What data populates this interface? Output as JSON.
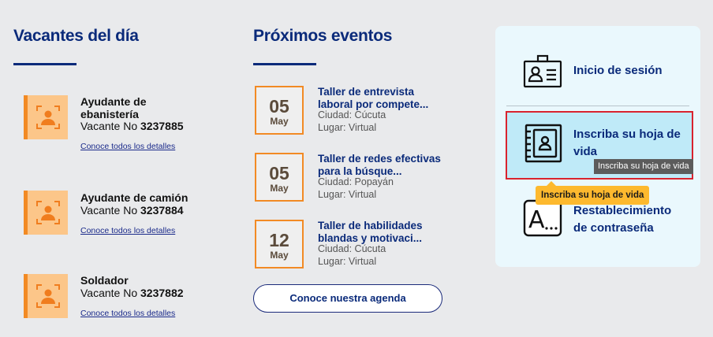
{
  "vacancies": {
    "heading": "Vacantes del día",
    "items": [
      {
        "title": "Ayudante de ebanistería",
        "vacante_label": "Vacante No",
        "number": "3237885",
        "link": "Conoce todos los detalles"
      },
      {
        "title": "Ayudante de camión",
        "vacante_label": "Vacante No",
        "number": "3237884",
        "link": "Conoce todos los detalles"
      },
      {
        "title": "Soldador",
        "vacante_label": "Vacante No",
        "number": "3237882",
        "link": "Conoce todos los detalles"
      }
    ]
  },
  "events": {
    "heading": "Próximos eventos",
    "items": [
      {
        "day": "05",
        "month": "May",
        "title": "Taller de entrevista laboral por compete...",
        "city": "Ciudad: Cúcuta",
        "place": "Lugar: Virtual"
      },
      {
        "day": "05",
        "month": "May",
        "title": "Taller de redes efectivas para la búsque...",
        "city": "Ciudad: Popayán",
        "place": "Lugar: Virtual"
      },
      {
        "day": "12",
        "month": "May",
        "title": "Taller de habilidades blandas y motivaci...",
        "city": "Ciudad: Cúcuta",
        "place": "Lugar: Virtual"
      }
    ],
    "agenda_button": "Conoce nuestra agenda"
  },
  "panel": {
    "items": [
      {
        "label": "Inicio de sesión",
        "icon": "id-badge-icon"
      },
      {
        "label": "Inscriba su hoja de vida",
        "icon": "address-book-icon"
      },
      {
        "label": "Restablecimiento de contraseña",
        "icon": "password-field-icon"
      }
    ],
    "tooltip_gray": "Inscriba su hoja de vida",
    "tooltip_yellow": "Inscriba su hoja de vida"
  },
  "colors": {
    "brand_blue": "#0a2a7a",
    "accent_orange": "#f28a24",
    "icon_fill": "#fcc689",
    "highlight_border": "#d9232e",
    "tooltip_yellow": "#fdb92e"
  }
}
